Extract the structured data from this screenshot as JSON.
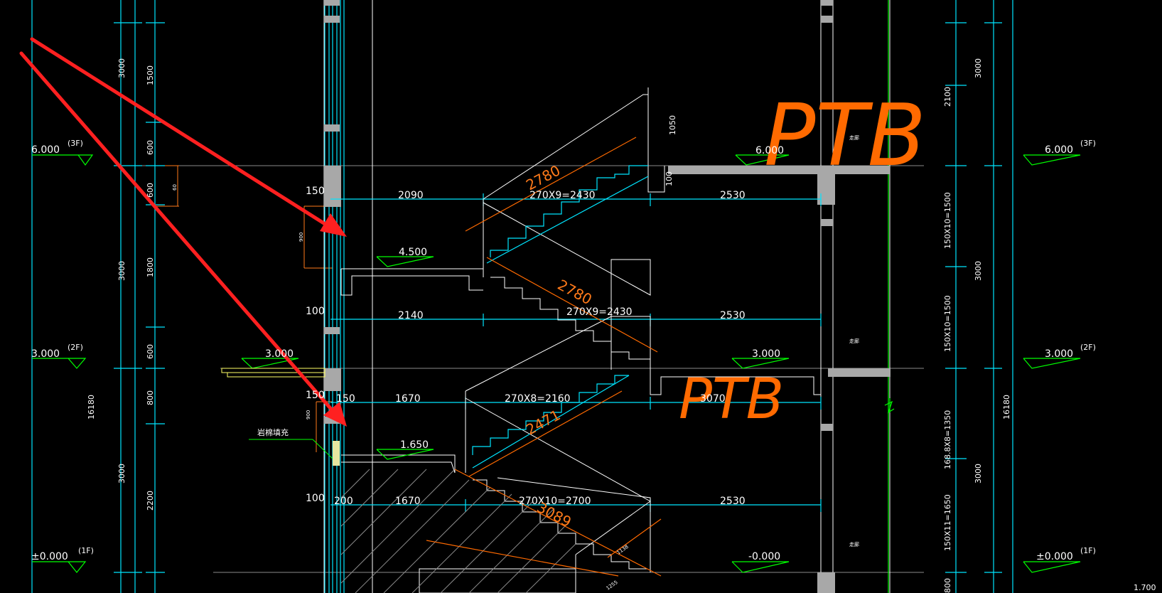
{
  "levels": {
    "left": [
      {
        "elev": "6.000",
        "tag": "(3F)"
      },
      {
        "elev": "3.000",
        "tag": "(2F)"
      },
      {
        "elev": "±0.000",
        "tag": "(1F)"
      }
    ],
    "right": [
      {
        "elev": "6.000",
        "tag": "(3F)"
      },
      {
        "elev": "3.000",
        "tag": "(2F)"
      },
      {
        "elev": "±0.000",
        "tag": "(1F)"
      }
    ],
    "inner": [
      "6.000",
      "4.500",
      "3.000",
      "3.000",
      "1.650",
      "-0.000"
    ]
  },
  "dims_left_outer": [
    "3000",
    "3000",
    "16180",
    "3000"
  ],
  "dims_left_inner": [
    "1500",
    "600",
    "600",
    "1800",
    "600",
    "800",
    "2200"
  ],
  "dims_left_tiny": [
    "900",
    "900",
    "60"
  ],
  "dims_wall": [
    "150",
    "100",
    "150",
    "100"
  ],
  "dims_right_inner": [
    "2100",
    "150X10=1500",
    "150X10=1500",
    "168.8X8=1350",
    "150X11=1650",
    "800"
  ],
  "dims_right_outer": [
    "3000",
    "3000",
    "16180",
    "3000"
  ],
  "dims_right_edge": "1.700",
  "rows": [
    {
      "a": "2090",
      "b": "270X9=2430",
      "c": "2530"
    },
    {
      "a": "2140",
      "b": "270X9=2430",
      "c": "2530"
    },
    {
      "a0": "150",
      "a": "1670",
      "b": "270X8=2160",
      "c": "3070"
    },
    {
      "a0": "200",
      "a": "1670",
      "b": "270X10=2700",
      "c": "2530"
    }
  ],
  "slopes": [
    "2780",
    "2780",
    "2471",
    "3089"
  ],
  "misc_dims": [
    "1050",
    "100",
    "1138",
    "1255",
    "100",
    "150",
    "150",
    "100"
  ],
  "note_fill": "岩棉填充",
  "room_labels": [
    "走廊",
    "走廊",
    "走廊"
  ],
  "handwritten": [
    "PTB",
    "PTB"
  ],
  "colors": {
    "bg": "#000000",
    "cyan": "#00e5ff",
    "white": "#ffffff",
    "green": "#00ff00",
    "red": "#ff2020",
    "orange": "#ff6a00",
    "gray": "#a8a8a8"
  }
}
